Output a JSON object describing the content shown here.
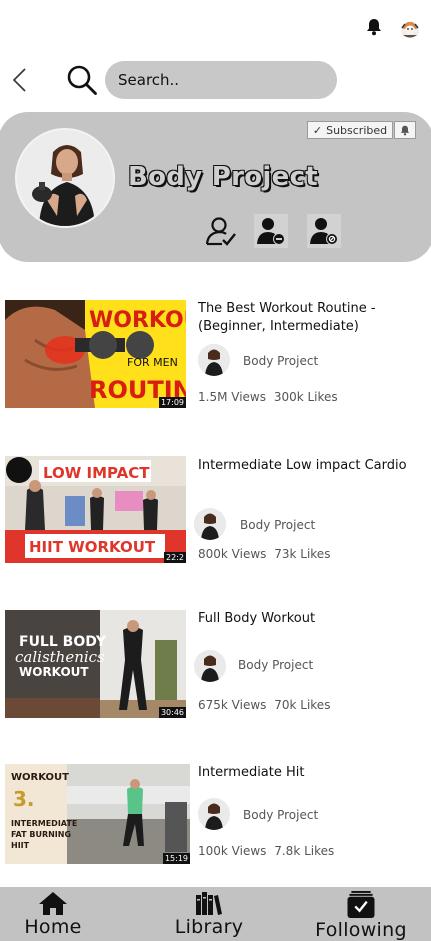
{
  "search": {
    "placeholder": "Search.."
  },
  "channel": {
    "name": "Body Project",
    "subscribe_label": "Subscribed",
    "subscribe_check": "✓"
  },
  "videos": [
    {
      "title": "The Best Workout Routine - (Beginner, Intermediate)",
      "channel": "Body Project",
      "views": "1.5M Views",
      "likes": "300k Likes",
      "duration": "17:09",
      "thumb_text": [
        "WORKOUT",
        "FOR MEN",
        "ROUTINE"
      ]
    },
    {
      "title": "Intermediate Low impact Cardio",
      "channel": "Body Project",
      "views": "800k Views",
      "likes": "73k Likes",
      "duration": "22:2",
      "thumb_text": [
        "LOW IMPACT",
        "HIIT WORKOUT"
      ]
    },
    {
      "title": "Full Body Workout",
      "channel": "Body Project",
      "views": "675k Views",
      "likes": "70k Likes",
      "duration": "30:46",
      "thumb_text": [
        "FULL BODY",
        "calisthenics",
        "WORKOUT"
      ]
    },
    {
      "title": "Intermediate Hit",
      "channel": "Body Project",
      "views": "100k Views",
      "likes": "7.8k Likes",
      "duration": "15:19",
      "thumb_text": [
        "WORKOUT",
        "3.",
        "INTERMEDIATE",
        "FAT BURNING",
        "HIIT"
      ]
    }
  ],
  "nav": {
    "home": "Home",
    "library": "Library",
    "following": "Following"
  },
  "colors": {
    "card_bg": "#c4c4c4",
    "nav_bg": "#c2c2c2",
    "search_bg": "#c8c8c8"
  }
}
